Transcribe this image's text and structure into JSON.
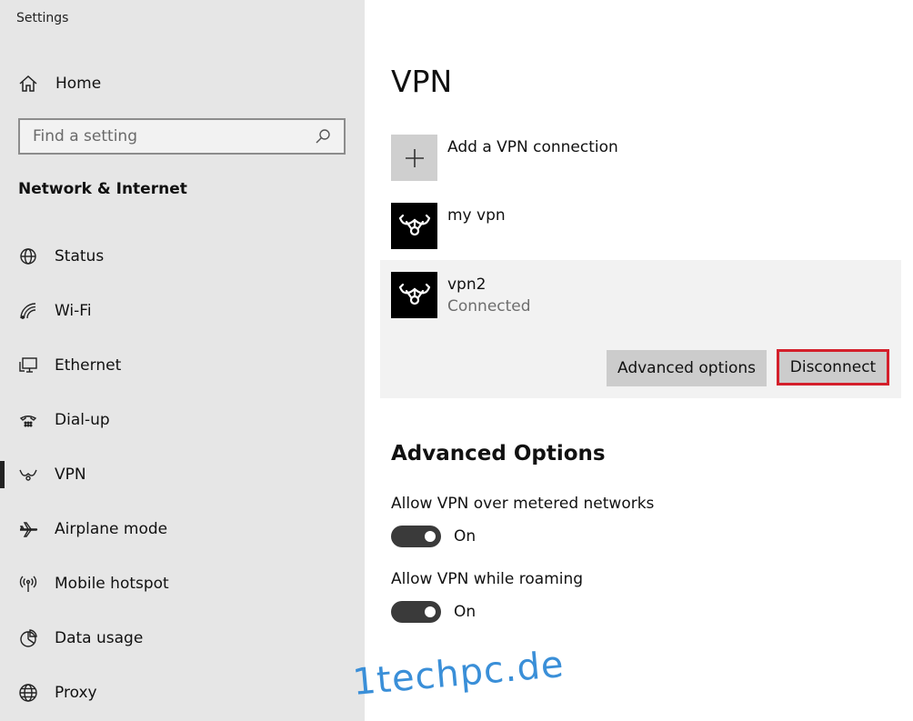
{
  "window": {
    "title": "Settings"
  },
  "sidebar": {
    "home_label": "Home",
    "search_placeholder": "Find a setting",
    "section_title": "Network & Internet",
    "items": [
      {
        "label": "Status",
        "icon": "globe-icon",
        "active": false
      },
      {
        "label": "Wi-Fi",
        "icon": "wifi-icon",
        "active": false
      },
      {
        "label": "Ethernet",
        "icon": "ethernet-icon",
        "active": false
      },
      {
        "label": "Dial-up",
        "icon": "dialup-icon",
        "active": false
      },
      {
        "label": "VPN",
        "icon": "vpn-icon",
        "active": true
      },
      {
        "label": "Airplane mode",
        "icon": "airplane-icon",
        "active": false
      },
      {
        "label": "Mobile hotspot",
        "icon": "hotspot-icon",
        "active": false
      },
      {
        "label": "Data usage",
        "icon": "data-usage-icon",
        "active": false
      },
      {
        "label": "Proxy",
        "icon": "proxy-icon",
        "active": false
      }
    ]
  },
  "main": {
    "title": "VPN",
    "add_connection_label": "Add a VPN connection",
    "connections": [
      {
        "name": "my vpn",
        "status": ""
      },
      {
        "name": "vpn2",
        "status": "Connected"
      }
    ],
    "advanced_options_button": "Advanced options",
    "disconnect_button": "Disconnect",
    "advanced_section_title": "Advanced Options",
    "options": [
      {
        "label": "Allow VPN over metered networks",
        "state": "On",
        "on": true
      },
      {
        "label": "Allow VPN while roaming",
        "state": "On",
        "on": true
      }
    ]
  },
  "watermark": "1techpc.de",
  "colors": {
    "sidebar_bg": "#e6e6e6",
    "highlight_border": "#d41f2b",
    "toggle_on": "#3a3a3a",
    "watermark": "#3a8fd8"
  }
}
